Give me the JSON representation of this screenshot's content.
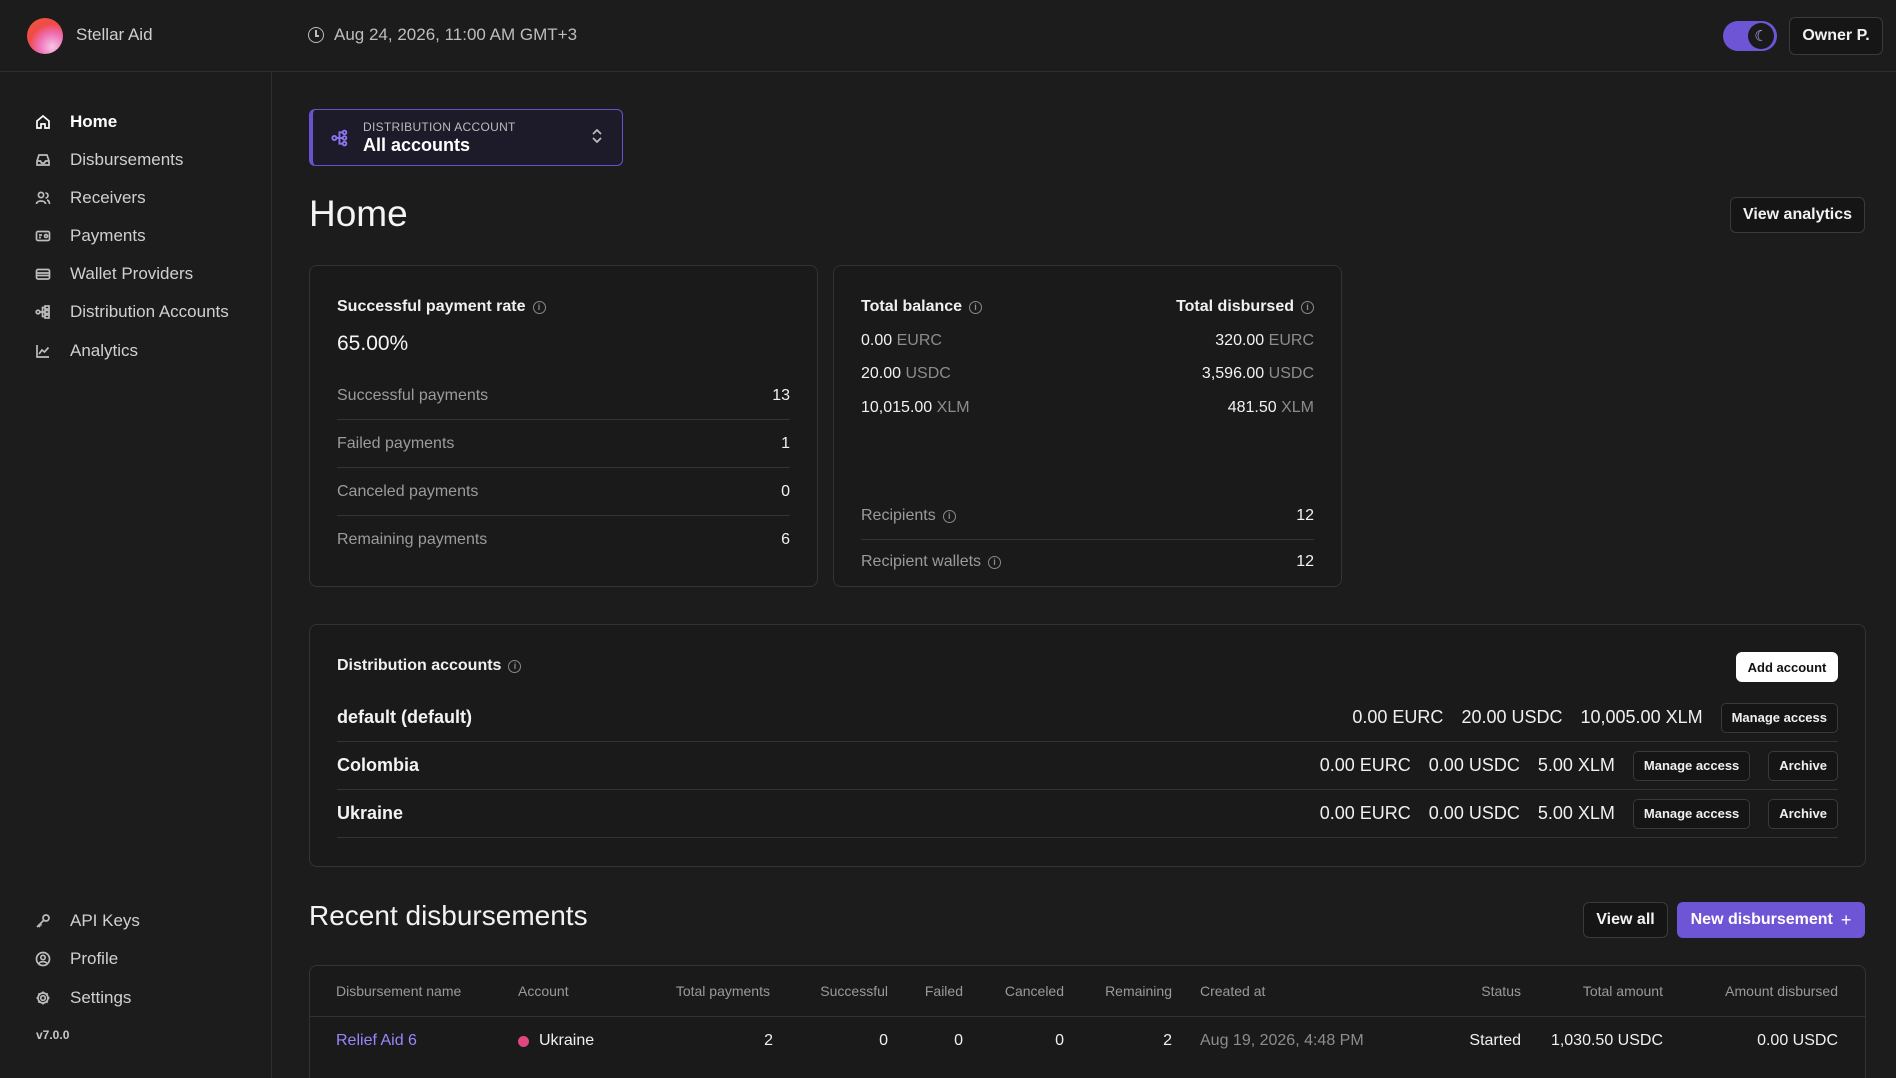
{
  "app": {
    "name": "Stellar Aid",
    "datetime": "Aug 24, 2026, 11:00 AM GMT+3",
    "user": "Owner P.",
    "version": "v7.0.0"
  },
  "sidebar": {
    "items": [
      {
        "label": "Home",
        "icon": "home-icon"
      },
      {
        "label": "Disbursements",
        "icon": "inbox-icon"
      },
      {
        "label": "Receivers",
        "icon": "users-icon"
      },
      {
        "label": "Payments",
        "icon": "payment-card-icon"
      },
      {
        "label": "Wallet Providers",
        "icon": "wallet-icon"
      },
      {
        "label": "Distribution Accounts",
        "icon": "network-icon"
      },
      {
        "label": "Analytics",
        "icon": "chart-line-icon"
      }
    ],
    "bottom": [
      {
        "label": "API Keys",
        "icon": "key-icon"
      },
      {
        "label": "Profile",
        "icon": "profile-icon"
      },
      {
        "label": "Settings",
        "icon": "gear-icon"
      }
    ]
  },
  "account_selector": {
    "label": "DISTRIBUTION ACCOUNT",
    "value": "All accounts"
  },
  "page": {
    "title": "Home",
    "view_analytics": "View analytics"
  },
  "payment_stats": {
    "title": "Successful payment rate",
    "rate": "65.00%",
    "rows": [
      {
        "label": "Successful payments",
        "value": "13"
      },
      {
        "label": "Failed payments",
        "value": "1"
      },
      {
        "label": "Canceled payments",
        "value": "0"
      },
      {
        "label": "Remaining payments",
        "value": "6"
      }
    ]
  },
  "balances": {
    "total_balance_title": "Total balance",
    "total_disbursed_title": "Total disbursed",
    "balance": [
      {
        "amount": "0.00",
        "asset": "EURC"
      },
      {
        "amount": "20.00",
        "asset": "USDC"
      },
      {
        "amount": "10,015.00",
        "asset": "XLM"
      }
    ],
    "disbursed": [
      {
        "amount": "320.00",
        "asset": "EURC"
      },
      {
        "amount": "3,596.00",
        "asset": "USDC"
      },
      {
        "amount": "481.50",
        "asset": "XLM"
      }
    ],
    "recipients_label": "Recipients",
    "recipients_value": "12",
    "wallets_label": "Recipient wallets",
    "wallets_value": "12"
  },
  "distribution_accounts": {
    "title": "Distribution accounts",
    "add_button": "Add account",
    "manage_label": "Manage access",
    "archive_label": "Archive",
    "rows": [
      {
        "name": "default (default)",
        "eurc": "0.00 EURC",
        "usdc": "20.00 USDC",
        "xlm": "10,005.00 XLM"
      },
      {
        "name": "Colombia",
        "eurc": "0.00 EURC",
        "usdc": "0.00 USDC",
        "xlm": "5.00 XLM"
      },
      {
        "name": "Ukraine",
        "eurc": "0.00 EURC",
        "usdc": "0.00 USDC",
        "xlm": "5.00 XLM"
      }
    ]
  },
  "recent": {
    "title": "Recent disbursements",
    "view_all": "View all",
    "new_button": "New disbursement",
    "new_icon": "+",
    "columns": [
      "Disbursement name",
      "Account",
      "Total payments",
      "Successful",
      "Failed",
      "Canceled",
      "Remaining",
      "Created at",
      "Status",
      "Total amount",
      "Amount disbursed"
    ],
    "rows": [
      {
        "name": "Relief Aid 6",
        "account": "Ukraine",
        "account_color": "#e0467f",
        "total": "2",
        "successful": "0",
        "failed": "0",
        "canceled": "0",
        "remaining": "2",
        "created": "Aug 19, 2026, 4:48 PM",
        "status": "Started",
        "total_amount": "1,030.50 USDC",
        "disbursed": "0.00 USDC"
      }
    ]
  },
  "colors": {
    "accent": "#6e55d6",
    "link": "#9b85ff",
    "background": "#1c1c1c"
  }
}
